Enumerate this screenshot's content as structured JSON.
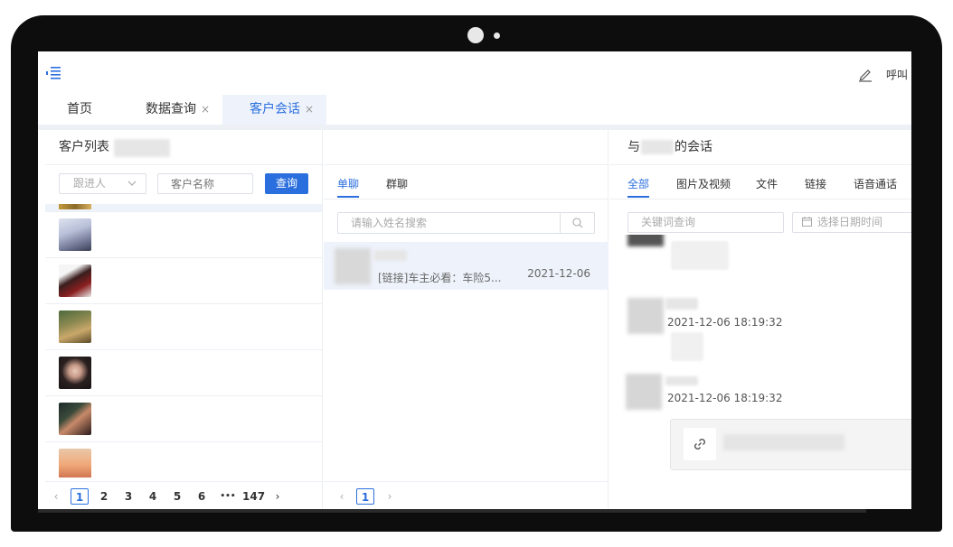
{
  "topbar": {
    "menu_icon": "menu-indent-icon",
    "edit_icon": "edit-pen-icon",
    "call_label": "呼叫"
  },
  "tabs": [
    {
      "label": "首页",
      "closable": false,
      "active": false
    },
    {
      "label": "数据查询",
      "closable": true,
      "active": false
    },
    {
      "label": "客户会话",
      "closable": true,
      "active": true
    }
  ],
  "tab_close": "×",
  "customer_panel": {
    "title": "客户列表",
    "follower_select": {
      "placeholder": "跟进人",
      "icon": "chevron-down-icon"
    },
    "name_input": {
      "placeholder": "客户名称",
      "value": ""
    },
    "query_button": "查询",
    "pager": {
      "prev": "‹",
      "pages": [
        "1",
        "2",
        "3",
        "4",
        "5",
        "6"
      ],
      "ellipsis": "•••",
      "last": "147",
      "next": "›",
      "current": "1"
    }
  },
  "session_panel": {
    "tabs": [
      "单聊",
      "群聊"
    ],
    "active_tab": "单聊",
    "search": {
      "placeholder": "请输入姓名搜索",
      "icon": "search-icon"
    },
    "sessions": [
      {
        "last_message": "[链接]车主必看：车险5...",
        "date": "2021-12-06"
      }
    ],
    "pager": {
      "prev": "‹",
      "current": "1",
      "next": "›"
    }
  },
  "chat_panel": {
    "title_prefix": "与",
    "title_suffix": "的会话",
    "tabs": [
      "全部",
      "图片及视频",
      "文件",
      "链接",
      "语音通话"
    ],
    "active_tab": "全部",
    "keyword_input": {
      "placeholder": "关键词查询"
    },
    "date_input": {
      "placeholder": "选择日期时间",
      "icon": "calendar-icon"
    },
    "messages": [
      {
        "time": "2021-12-06 18:19:32",
        "type": "text"
      },
      {
        "time": "2021-12-06 18:19:32",
        "type": "link"
      }
    ],
    "link_icon": "link-chain-icon"
  },
  "colors": {
    "accent": "#2b6fde",
    "selected_row": "#eef3fb",
    "frame": "#0d0d0d"
  }
}
